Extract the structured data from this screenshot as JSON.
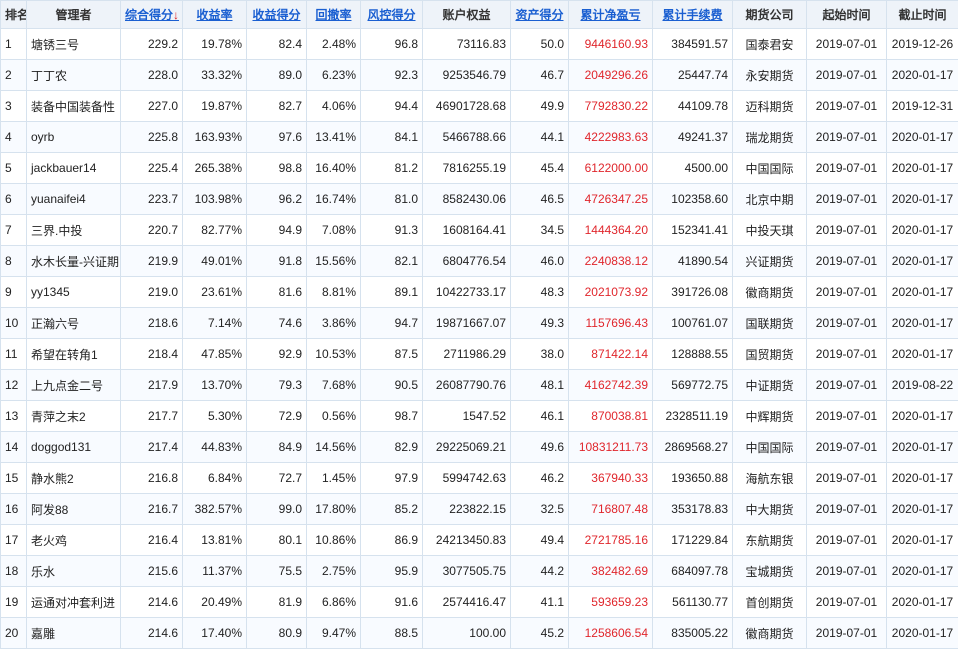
{
  "headers": [
    {
      "key": "rank",
      "label": "排名",
      "sortable": false
    },
    {
      "key": "manager",
      "label": "管理者",
      "sortable": false
    },
    {
      "key": "total_score",
      "label": "综合得分",
      "sortable": true,
      "active": true,
      "arrow": "↓"
    },
    {
      "key": "return_rate",
      "label": "收益率",
      "sortable": true
    },
    {
      "key": "return_score",
      "label": "收益得分",
      "sortable": true
    },
    {
      "key": "drawdown",
      "label": "回撤率",
      "sortable": true
    },
    {
      "key": "risk_score",
      "label": "风控得分",
      "sortable": true
    },
    {
      "key": "equity",
      "label": "账户权益",
      "sortable": false
    },
    {
      "key": "asset_score",
      "label": "资产得分",
      "sortable": true
    },
    {
      "key": "net_profit",
      "label": "累计净盈亏",
      "sortable": true
    },
    {
      "key": "fees",
      "label": "累计手续费",
      "sortable": true
    },
    {
      "key": "company",
      "label": "期货公司",
      "sortable": false
    },
    {
      "key": "start",
      "label": "起始时间",
      "sortable": false
    },
    {
      "key": "end",
      "label": "截止时间",
      "sortable": false
    }
  ],
  "rows": [
    {
      "rank": "1",
      "manager": "塘锈三号",
      "total_score": "229.2",
      "return_rate": "19.78%",
      "return_score": "82.4",
      "drawdown": "2.48%",
      "risk_score": "96.8",
      "equity": "73116.83",
      "asset_score": "50.0",
      "net_profit": "9446160.93",
      "fees": "384591.57",
      "company": "国泰君安",
      "start": "2019-07-01",
      "end": "2019-12-26"
    },
    {
      "rank": "2",
      "manager": "丁丁农",
      "total_score": "228.0",
      "return_rate": "33.32%",
      "return_score": "89.0",
      "drawdown": "6.23%",
      "risk_score": "92.3",
      "equity": "9253546.79",
      "asset_score": "46.7",
      "net_profit": "2049296.26",
      "fees": "25447.74",
      "company": "永安期货",
      "start": "2019-07-01",
      "end": "2020-01-17"
    },
    {
      "rank": "3",
      "manager": "装备中国装备性",
      "total_score": "227.0",
      "return_rate": "19.87%",
      "return_score": "82.7",
      "drawdown": "4.06%",
      "risk_score": "94.4",
      "equity": "46901728.68",
      "asset_score": "49.9",
      "net_profit": "7792830.22",
      "fees": "44109.78",
      "company": "迈科期货",
      "start": "2019-07-01",
      "end": "2019-12-31"
    },
    {
      "rank": "4",
      "manager": "oyrb",
      "total_score": "225.8",
      "return_rate": "163.93%",
      "return_score": "97.6",
      "drawdown": "13.41%",
      "risk_score": "84.1",
      "equity": "5466788.66",
      "asset_score": "44.1",
      "net_profit": "4222983.63",
      "fees": "49241.37",
      "company": "瑞龙期货",
      "start": "2019-07-01",
      "end": "2020-01-17"
    },
    {
      "rank": "5",
      "manager": "jackbauer14",
      "total_score": "225.4",
      "return_rate": "265.38%",
      "return_score": "98.8",
      "drawdown": "16.40%",
      "risk_score": "81.2",
      "equity": "7816255.19",
      "asset_score": "45.4",
      "net_profit": "6122000.00",
      "fees": "4500.00",
      "company": "中国国际",
      "start": "2019-07-01",
      "end": "2020-01-17"
    },
    {
      "rank": "6",
      "manager": "yuanaifei4",
      "total_score": "223.7",
      "return_rate": "103.98%",
      "return_score": "96.2",
      "drawdown": "16.74%",
      "risk_score": "81.0",
      "equity": "8582430.06",
      "asset_score": "46.5",
      "net_profit": "4726347.25",
      "fees": "102358.60",
      "company": "北京中期",
      "start": "2019-07-01",
      "end": "2020-01-17"
    },
    {
      "rank": "7",
      "manager": "三界.中投",
      "total_score": "220.7",
      "return_rate": "82.77%",
      "return_score": "94.9",
      "drawdown": "7.08%",
      "risk_score": "91.3",
      "equity": "1608164.41",
      "asset_score": "34.5",
      "net_profit": "1444364.20",
      "fees": "152341.41",
      "company": "中投天琪",
      "start": "2019-07-01",
      "end": "2020-01-17"
    },
    {
      "rank": "8",
      "manager": "水木长量-兴证期",
      "total_score": "219.9",
      "return_rate": "49.01%",
      "return_score": "91.8",
      "drawdown": "15.56%",
      "risk_score": "82.1",
      "equity": "6804776.54",
      "asset_score": "46.0",
      "net_profit": "2240838.12",
      "fees": "41890.54",
      "company": "兴证期货",
      "start": "2019-07-01",
      "end": "2020-01-17"
    },
    {
      "rank": "9",
      "manager": "yy1345",
      "total_score": "219.0",
      "return_rate": "23.61%",
      "return_score": "81.6",
      "drawdown": "8.81%",
      "risk_score": "89.1",
      "equity": "10422733.17",
      "asset_score": "48.3",
      "net_profit": "2021073.92",
      "fees": "391726.08",
      "company": "徽商期货",
      "start": "2019-07-01",
      "end": "2020-01-17"
    },
    {
      "rank": "10",
      "manager": "正瀚六号",
      "total_score": "218.6",
      "return_rate": "7.14%",
      "return_score": "74.6",
      "drawdown": "3.86%",
      "risk_score": "94.7",
      "equity": "19871667.07",
      "asset_score": "49.3",
      "net_profit": "1157696.43",
      "fees": "100761.07",
      "company": "国联期货",
      "start": "2019-07-01",
      "end": "2020-01-17"
    },
    {
      "rank": "11",
      "manager": "希望在转角1",
      "total_score": "218.4",
      "return_rate": "47.85%",
      "return_score": "92.9",
      "drawdown": "10.53%",
      "risk_score": "87.5",
      "equity": "2711986.29",
      "asset_score": "38.0",
      "net_profit": "871422.14",
      "fees": "128888.55",
      "company": "国贸期货",
      "start": "2019-07-01",
      "end": "2020-01-17"
    },
    {
      "rank": "12",
      "manager": "上九点金二号",
      "total_score": "217.9",
      "return_rate": "13.70%",
      "return_score": "79.3",
      "drawdown": "7.68%",
      "risk_score": "90.5",
      "equity": "26087790.76",
      "asset_score": "48.1",
      "net_profit": "4162742.39",
      "fees": "569772.75",
      "company": "中证期货",
      "start": "2019-07-01",
      "end": "2019-08-22"
    },
    {
      "rank": "13",
      "manager": "青萍之末2",
      "total_score": "217.7",
      "return_rate": "5.30%",
      "return_score": "72.9",
      "drawdown": "0.56%",
      "risk_score": "98.7",
      "equity": "1547.52",
      "asset_score": "46.1",
      "net_profit": "870038.81",
      "fees": "2328511.19",
      "company": "中辉期货",
      "start": "2019-07-01",
      "end": "2020-01-17"
    },
    {
      "rank": "14",
      "manager": "doggod131",
      "total_score": "217.4",
      "return_rate": "44.83%",
      "return_score": "84.9",
      "drawdown": "14.56%",
      "risk_score": "82.9",
      "equity": "29225069.21",
      "asset_score": "49.6",
      "net_profit": "10831211.73",
      "fees": "2869568.27",
      "company": "中国国际",
      "start": "2019-07-01",
      "end": "2020-01-17"
    },
    {
      "rank": "15",
      "manager": "静水熊2",
      "total_score": "216.8",
      "return_rate": "6.84%",
      "return_score": "72.7",
      "drawdown": "1.45%",
      "risk_score": "97.9",
      "equity": "5994742.63",
      "asset_score": "46.2",
      "net_profit": "367940.33",
      "fees": "193650.88",
      "company": "海航东银",
      "start": "2019-07-01",
      "end": "2020-01-17"
    },
    {
      "rank": "16",
      "manager": "阿发88",
      "total_score": "216.7",
      "return_rate": "382.57%",
      "return_score": "99.0",
      "drawdown": "17.80%",
      "risk_score": "85.2",
      "equity": "223822.15",
      "asset_score": "32.5",
      "net_profit": "716807.48",
      "fees": "353178.83",
      "company": "中大期货",
      "start": "2019-07-01",
      "end": "2020-01-17"
    },
    {
      "rank": "17",
      "manager": "老火鸡",
      "total_score": "216.4",
      "return_rate": "13.81%",
      "return_score": "80.1",
      "drawdown": "10.86%",
      "risk_score": "86.9",
      "equity": "24213450.83",
      "asset_score": "49.4",
      "net_profit": "2721785.16",
      "fees": "171229.84",
      "company": "东航期货",
      "start": "2019-07-01",
      "end": "2020-01-17"
    },
    {
      "rank": "18",
      "manager": "乐水",
      "total_score": "215.6",
      "return_rate": "11.37%",
      "return_score": "75.5",
      "drawdown": "2.75%",
      "risk_score": "95.9",
      "equity": "3077505.75",
      "asset_score": "44.2",
      "net_profit": "382482.69",
      "fees": "684097.78",
      "company": "宝城期货",
      "start": "2019-07-01",
      "end": "2020-01-17"
    },
    {
      "rank": "19",
      "manager": "运通对冲套利进",
      "total_score": "214.6",
      "return_rate": "20.49%",
      "return_score": "81.9",
      "drawdown": "6.86%",
      "risk_score": "91.6",
      "equity": "2574416.47",
      "asset_score": "41.1",
      "net_profit": "593659.23",
      "fees": "561130.77",
      "company": "首创期货",
      "start": "2019-07-01",
      "end": "2020-01-17"
    },
    {
      "rank": "20",
      "manager": "嘉雕",
      "total_score": "214.6",
      "return_rate": "17.40%",
      "return_score": "80.9",
      "drawdown": "9.47%",
      "risk_score": "88.5",
      "equity": "100.00",
      "asset_score": "45.2",
      "net_profit": "1258606.54",
      "fees": "835005.22",
      "company": "徽商期货",
      "start": "2019-07-01",
      "end": "2020-01-17"
    }
  ],
  "colors": {
    "header_link": "#1a5fd1",
    "profit_red": "#e0262c",
    "sort_arrow": "#e02020",
    "header_bg": "#eef3f9",
    "border": "#d6e2ee"
  }
}
